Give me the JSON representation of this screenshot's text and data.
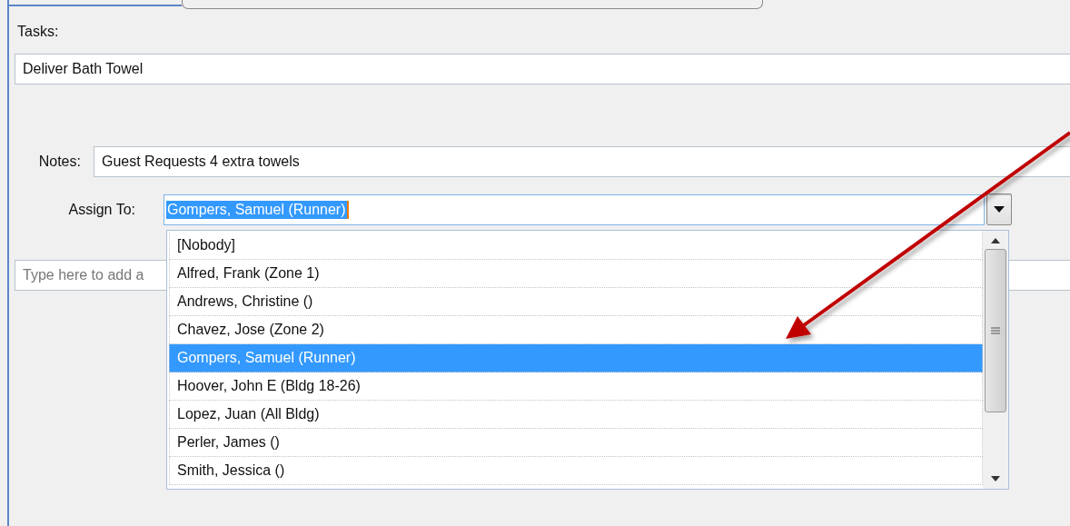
{
  "tasks": {
    "label": "Tasks:",
    "value": "Deliver Bath Towel"
  },
  "notes": {
    "label": "Notes:",
    "value": "Guest Requests 4 extra towels"
  },
  "assign_to": {
    "label": "Assign To:",
    "value": "Gompers, Samuel (Runner)",
    "text_highlighted": true,
    "expanded": true,
    "options": [
      {
        "label": "[Nobody]",
        "selected": false
      },
      {
        "label": "Alfred, Frank (Zone 1)",
        "selected": false
      },
      {
        "label": "Andrews, Christine ()",
        "selected": false
      },
      {
        "label": "Chavez, Jose (Zone 2)",
        "selected": false
      },
      {
        "label": "Gompers, Samuel (Runner)",
        "selected": true
      },
      {
        "label": "Hoover, John E (Bldg 18-26)",
        "selected": false
      },
      {
        "label": "Lopez, Juan (All Bldg)",
        "selected": false
      },
      {
        "label": "Perler, James ()",
        "selected": false
      },
      {
        "label": "Smith, Jessica ()",
        "selected": false
      }
    ]
  },
  "add_item": {
    "placeholder": "Type here to add a"
  }
}
